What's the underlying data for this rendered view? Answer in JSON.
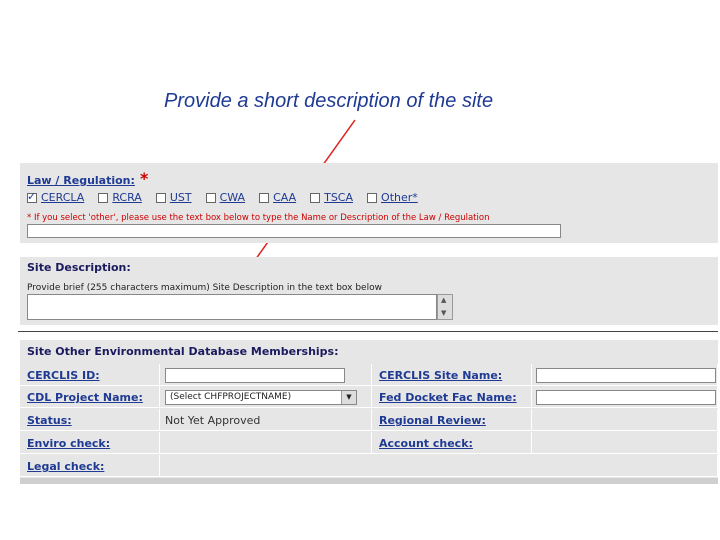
{
  "caption": "Provide a short description of the site",
  "law": {
    "title": "Law / Regulation:",
    "required_mark": "*",
    "options": [
      {
        "label": "CERCLA",
        "checked": true
      },
      {
        "label": "RCRA",
        "checked": false
      },
      {
        "label": "UST",
        "checked": false
      },
      {
        "label": "CWA",
        "checked": false
      },
      {
        "label": "CAA",
        "checked": false
      },
      {
        "label": "TSCA",
        "checked": false
      },
      {
        "label": "Other*",
        "checked": false
      }
    ],
    "note": "* If you select 'other', please use the text box below to type the Name or Description of the Law / Regulation",
    "other_value": ""
  },
  "site_description": {
    "title": "Site Description:",
    "hint": "Provide brief (255 characters maximum) Site Description in the text box below",
    "value": ""
  },
  "memberships": {
    "title": "Site Other Environmental Database Memberships:",
    "cercla_id_label": "CERCLIS ID:",
    "cercla_site_name_label": "CERCLIS Site Name:",
    "project_name_label": "CDL Project Name:",
    "project_select_value": "(Select CHFPROJECTNAME)",
    "fed_docket_label": "Fed Docket Fac Name:",
    "status_label": "Status:",
    "status_value": "Not Yet Approved",
    "regional_review_label": "Regional Review:",
    "enviro_check_label": "Enviro check:",
    "account_check_label": "Account check:",
    "legal_check_label": "Legal check:"
  },
  "colors": {
    "accent": "#1f3a93",
    "required": "#cc0000",
    "panel": "#e6e6e6",
    "arrow": "#dd2222"
  }
}
